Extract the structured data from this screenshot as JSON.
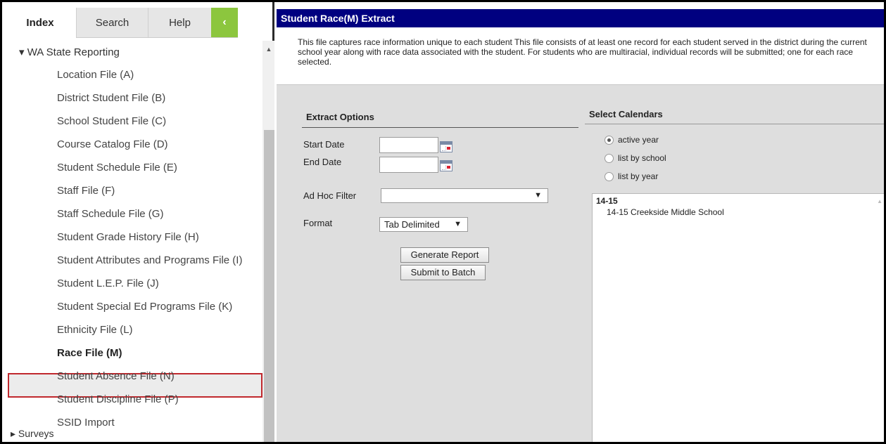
{
  "tabs": {
    "index": "Index",
    "search": "Search",
    "help": "Help",
    "collapse": "‹"
  },
  "nav": {
    "folder": "▾ WA State Reporting",
    "items": [
      "Location File (A)",
      "District Student File (B)",
      "School Student File (C)",
      "Course Catalog File (D)",
      "Student Schedule File (E)",
      "Staff File (F)",
      "Staff Schedule File (G)",
      "Student Grade History File (H)",
      "Student Attributes and Programs File (I)",
      "Student L.E.P. File (J)",
      "Student Special Ed Programs File (K)",
      "Ethnicity File (L)",
      "Race File (M)",
      "Student Absence File (N)",
      "Student Discipline File (P)",
      "SSID Import"
    ],
    "selected_index": 12,
    "next_folder": "▸ Surveys"
  },
  "header": {
    "title": "Student Race(M) Extract"
  },
  "description": "This file captures race information unique to each student This file consists of at least one record for each student served in the district during the current school year along with race data associated with the student. For students who are multiracial, individual records will be submitted; one for each race selected.",
  "extract_options": {
    "title": "Extract Options",
    "start_date_label": "Start Date",
    "start_date_value": "",
    "end_date_label": "End Date",
    "end_date_value": "",
    "adhoc_label": "Ad Hoc Filter",
    "adhoc_value": "",
    "format_label": "Format",
    "format_value": "Tab Delimited",
    "generate_button": "Generate Report",
    "batch_button": "Submit to Batch"
  },
  "select_calendars": {
    "title": "Select Calendars",
    "options": [
      "active year",
      "list by school",
      "list by year"
    ],
    "selected": "active year",
    "year": "14-15",
    "school": "14-15 Creekside Middle School"
  }
}
